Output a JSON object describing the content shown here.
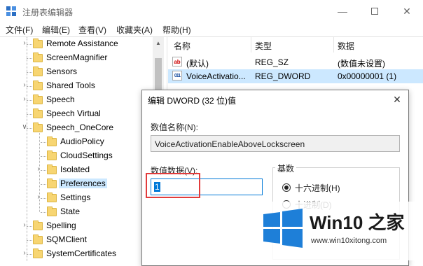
{
  "window": {
    "title": "注册表编辑器"
  },
  "menu": [
    "文件(F)",
    "编辑(E)",
    "查看(V)",
    "收藏夹(A)",
    "帮助(H)"
  ],
  "tree": [
    {
      "label": "Remote Assistance",
      "expand": ">",
      "level": 1,
      "selected": false
    },
    {
      "label": "ScreenMagnifier",
      "expand": "",
      "level": 1,
      "selected": false
    },
    {
      "label": "Sensors",
      "expand": "",
      "level": 1,
      "selected": false
    },
    {
      "label": "Shared Tools",
      "expand": ">",
      "level": 1,
      "selected": false
    },
    {
      "label": "Speech",
      "expand": ">",
      "level": 1,
      "selected": false
    },
    {
      "label": "Speech Virtual",
      "expand": "",
      "level": 1,
      "selected": false
    },
    {
      "label": "Speech_OneCore",
      "expand": "v",
      "level": 1,
      "selected": false
    },
    {
      "label": "AudioPolicy",
      "expand": "",
      "level": 2,
      "selected": false
    },
    {
      "label": "CloudSettings",
      "expand": "",
      "level": 2,
      "selected": false
    },
    {
      "label": "Isolated",
      "expand": ">",
      "level": 2,
      "selected": false
    },
    {
      "label": "Preferences",
      "expand": "",
      "level": 2,
      "selected": true
    },
    {
      "label": "Settings",
      "expand": ">",
      "level": 2,
      "selected": false
    },
    {
      "label": "State",
      "expand": "",
      "level": 2,
      "selected": false
    },
    {
      "label": "Spelling",
      "expand": ">",
      "level": 1,
      "selected": false
    },
    {
      "label": "SQMClient",
      "expand": "",
      "level": 1,
      "selected": false
    },
    {
      "label": "SystemCertificates",
      "expand": ">",
      "level": 1,
      "selected": false
    }
  ],
  "values_header": {
    "name": "名称",
    "type": "类型",
    "data": "数据"
  },
  "values": [
    {
      "name": "(默认)",
      "type": "REG_SZ",
      "data": "(数值未设置)",
      "icon": "string-value-icon"
    },
    {
      "name": "VoiceActivatio...",
      "type": "REG_DWORD",
      "data": "0x00000001 (1)",
      "icon": "binary-value-icon"
    }
  ],
  "dialog": {
    "title": "编辑 DWORD (32 位)值",
    "name_label": "数值名称(N):",
    "name_value": "VoiceActivationEnableAboveLockscreen",
    "data_label": "数值数据(V):",
    "data_value": "1",
    "base_label": "基数",
    "hex_label": "十六进制(H)",
    "dec_label": "十进制(D)",
    "base_selected": "hex"
  },
  "watermark": {
    "brand": "Win10 之家",
    "url": "www.win10xitong.com"
  },
  "colors": {
    "selection": "#cce8ff",
    "accent": "#0078d7",
    "highlight_box": "#e23b3b",
    "folder": "#f7d572",
    "win_logo": "#1e7fd8"
  }
}
